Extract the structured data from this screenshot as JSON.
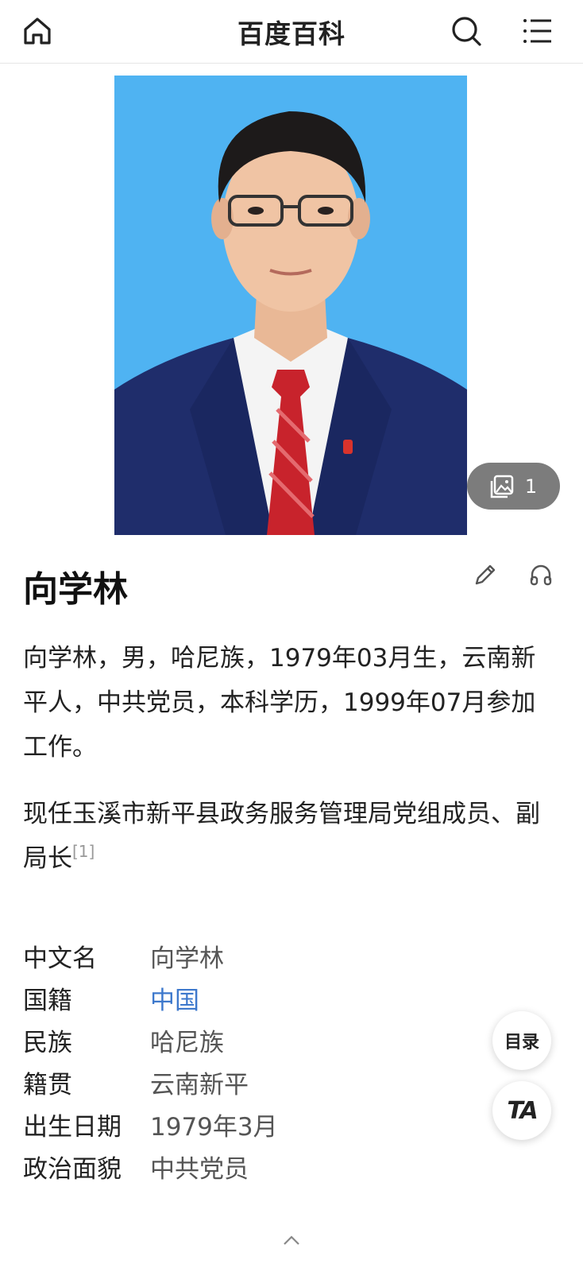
{
  "header": {
    "title": "百度百科",
    "icons": [
      "home-icon",
      "search-icon",
      "menu-icon"
    ]
  },
  "photo": {
    "album_count": "1",
    "colors": {
      "background": "#4fb2f0",
      "suit": "#1f2f6e",
      "tie": "#c8232c"
    }
  },
  "entry": {
    "name": "向学林",
    "actions": [
      "edit-icon",
      "listen-icon"
    ]
  },
  "summary": {
    "paragraph1": "向学林，男，哈尼族，1979年03月生，云南新平人，中共党员，本科学历，1999年07月参加工作。",
    "paragraph2_text": "现任玉溪市新平县政务服务管理局党组成员、副局长",
    "paragraph2_ref": "[1]"
  },
  "infobox": [
    {
      "key": "中文名",
      "value": "向学林",
      "link": false
    },
    {
      "key": "国籍",
      "value": "中国",
      "link": true
    },
    {
      "key": "民族",
      "value": "哈尼族",
      "link": false
    },
    {
      "key": "籍贯",
      "value": "云南新平",
      "link": false
    },
    {
      "key": "出生日期",
      "value": "1979年3月",
      "link": false
    },
    {
      "key": "政治面貌",
      "value": "中共党员",
      "link": false
    }
  ],
  "floating": {
    "toc_label": "目录",
    "ta_label": "TA"
  },
  "colors": {
    "link": "#3d78cc",
    "text": "#222222"
  }
}
